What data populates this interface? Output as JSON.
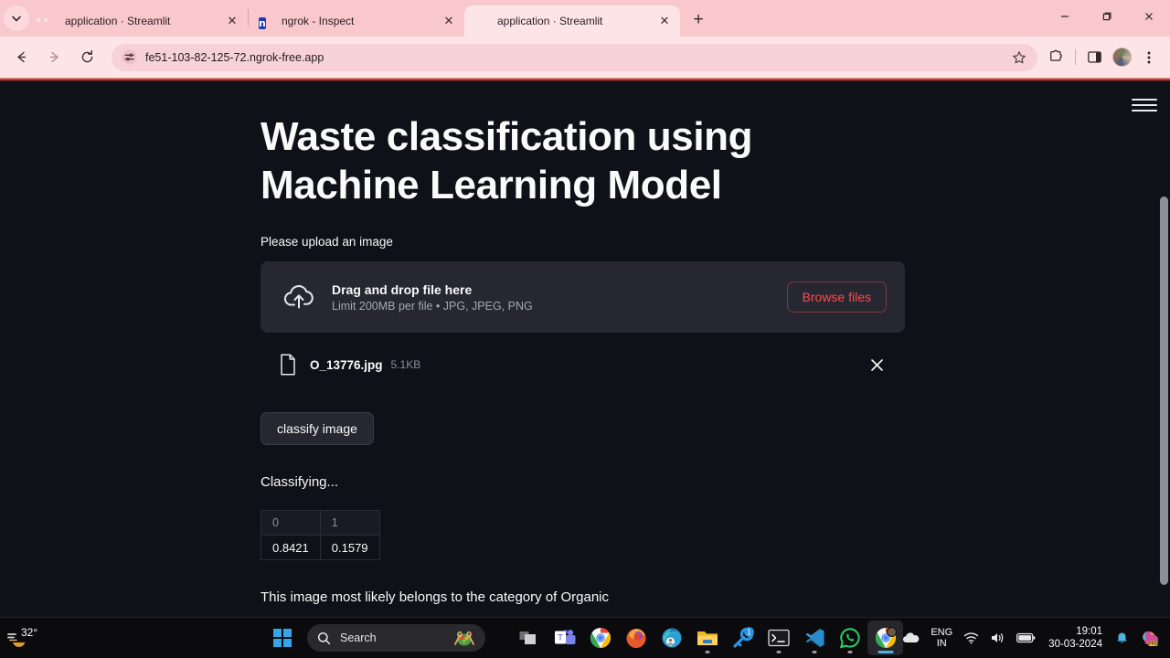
{
  "browser": {
    "tabs": [
      {
        "title": "application · Streamlit",
        "favicon": "streamlit-icon",
        "active": false
      },
      {
        "title": "ngrok - Inspect",
        "favicon": "ngrok-icon",
        "active": false
      },
      {
        "title": "application · Streamlit",
        "favicon": "streamlit-icon",
        "active": true
      }
    ],
    "new_tab_label": "+",
    "close_label": "✕",
    "nav": {
      "back": "←",
      "forward": "→",
      "reload": "⟳"
    },
    "omnibox": {
      "url": "fe51-103-82-125-72.ngrok-free.app",
      "site_icon": "site-settings-icon"
    },
    "toolbar_icons": [
      "bookmark-star-icon",
      "extensions-icon",
      "side-panel-icon",
      "profile-avatar",
      "chrome-menu-icon"
    ],
    "window_controls": {
      "minimize": "—",
      "maximize": "❐",
      "close": "✕"
    }
  },
  "page": {
    "title": "Waste classification using Machine Learning Model",
    "upload_label": "Please upload an image",
    "uploader": {
      "drag_text": "Drag and drop file here",
      "limit_text": "Limit 200MB per file • JPG, JPEG, PNG",
      "browse_label": "Browse files",
      "accent_color": "#ff4b4b"
    },
    "uploaded_file": {
      "name": "O_13776.jpg",
      "size": "5.1KB",
      "remove_label": "✕"
    },
    "classify_button": "classify image",
    "status": "Classifying...",
    "result": "This image most likely belongs to the category of Organic",
    "menu_label": "main-menu"
  },
  "chart_data": {
    "type": "table",
    "title": "Classification probabilities",
    "categories": [
      "0",
      "1"
    ],
    "values": [
      0.8421,
      0.1579
    ],
    "rows": [
      [
        "0.8421",
        "0.1579"
      ]
    ]
  },
  "taskbar": {
    "weather_temp": "32°",
    "search_placeholder": "Search",
    "apps": [
      {
        "name": "task-view",
        "badge": ""
      },
      {
        "name": "microsoft-teams",
        "badge": ""
      },
      {
        "name": "google-chrome",
        "badge": ""
      },
      {
        "name": "mozilla-firefox",
        "badge": ""
      },
      {
        "name": "microsoft-edge",
        "badge": ""
      },
      {
        "name": "file-explorer",
        "badge": ""
      },
      {
        "name": "key-app",
        "badge": "1"
      },
      {
        "name": "terminal",
        "badge": ""
      },
      {
        "name": "vs-code",
        "badge": ""
      },
      {
        "name": "whatsapp",
        "badge": ""
      },
      {
        "name": "chrome-active",
        "badge": ""
      }
    ],
    "tray": {
      "language": "ENG",
      "region": "IN",
      "time": "19:01",
      "date": "30-03-2024"
    }
  }
}
